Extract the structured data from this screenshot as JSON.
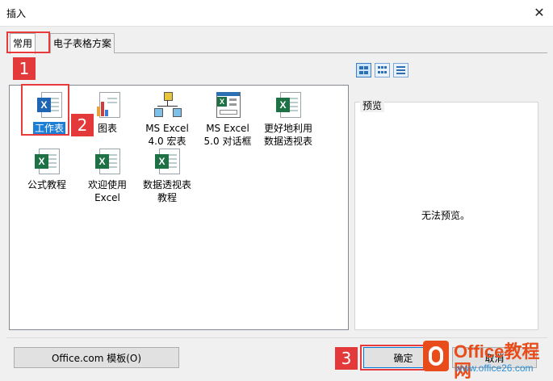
{
  "window": {
    "title": "插入",
    "close_glyph": "✕"
  },
  "tabs": [
    {
      "label": "常用",
      "active": true
    },
    {
      "label": "电子表格方案",
      "active": false
    }
  ],
  "items": [
    {
      "label": "工作表",
      "icon": "excel-worksheet-icon",
      "selected": true
    },
    {
      "label": "图表",
      "icon": "chart-icon"
    },
    {
      "label": "MS Excel\n4.0 宏表",
      "icon": "macro-sheet-icon"
    },
    {
      "label": "MS Excel\n5.0 对话框",
      "icon": "dialog-icon"
    },
    {
      "label": "更好地利用\n数据透视表",
      "icon": "excel-template-icon"
    },
    {
      "label": "公式教程",
      "icon": "excel-template-icon"
    },
    {
      "label": "欢迎使用\nExcel",
      "icon": "excel-template-icon"
    },
    {
      "label": "数据透视表\n教程",
      "icon": "excel-template-icon"
    }
  ],
  "view_buttons": [
    "large-icons-view",
    "list-view",
    "details-view"
  ],
  "preview": {
    "label": "预览",
    "empty_text": "无法预览。"
  },
  "buttons": {
    "templates": "Office.com 模板(O)",
    "ok": "确定",
    "cancel": "取消"
  },
  "annotations": [
    "1",
    "2",
    "3"
  ],
  "watermark": {
    "brand": "Office教程网",
    "url": "www.office26.com"
  },
  "colors": {
    "annotation_red": "#e4393a",
    "selection_blue": "#1c7fd5",
    "excel_green": "#1e7145"
  }
}
